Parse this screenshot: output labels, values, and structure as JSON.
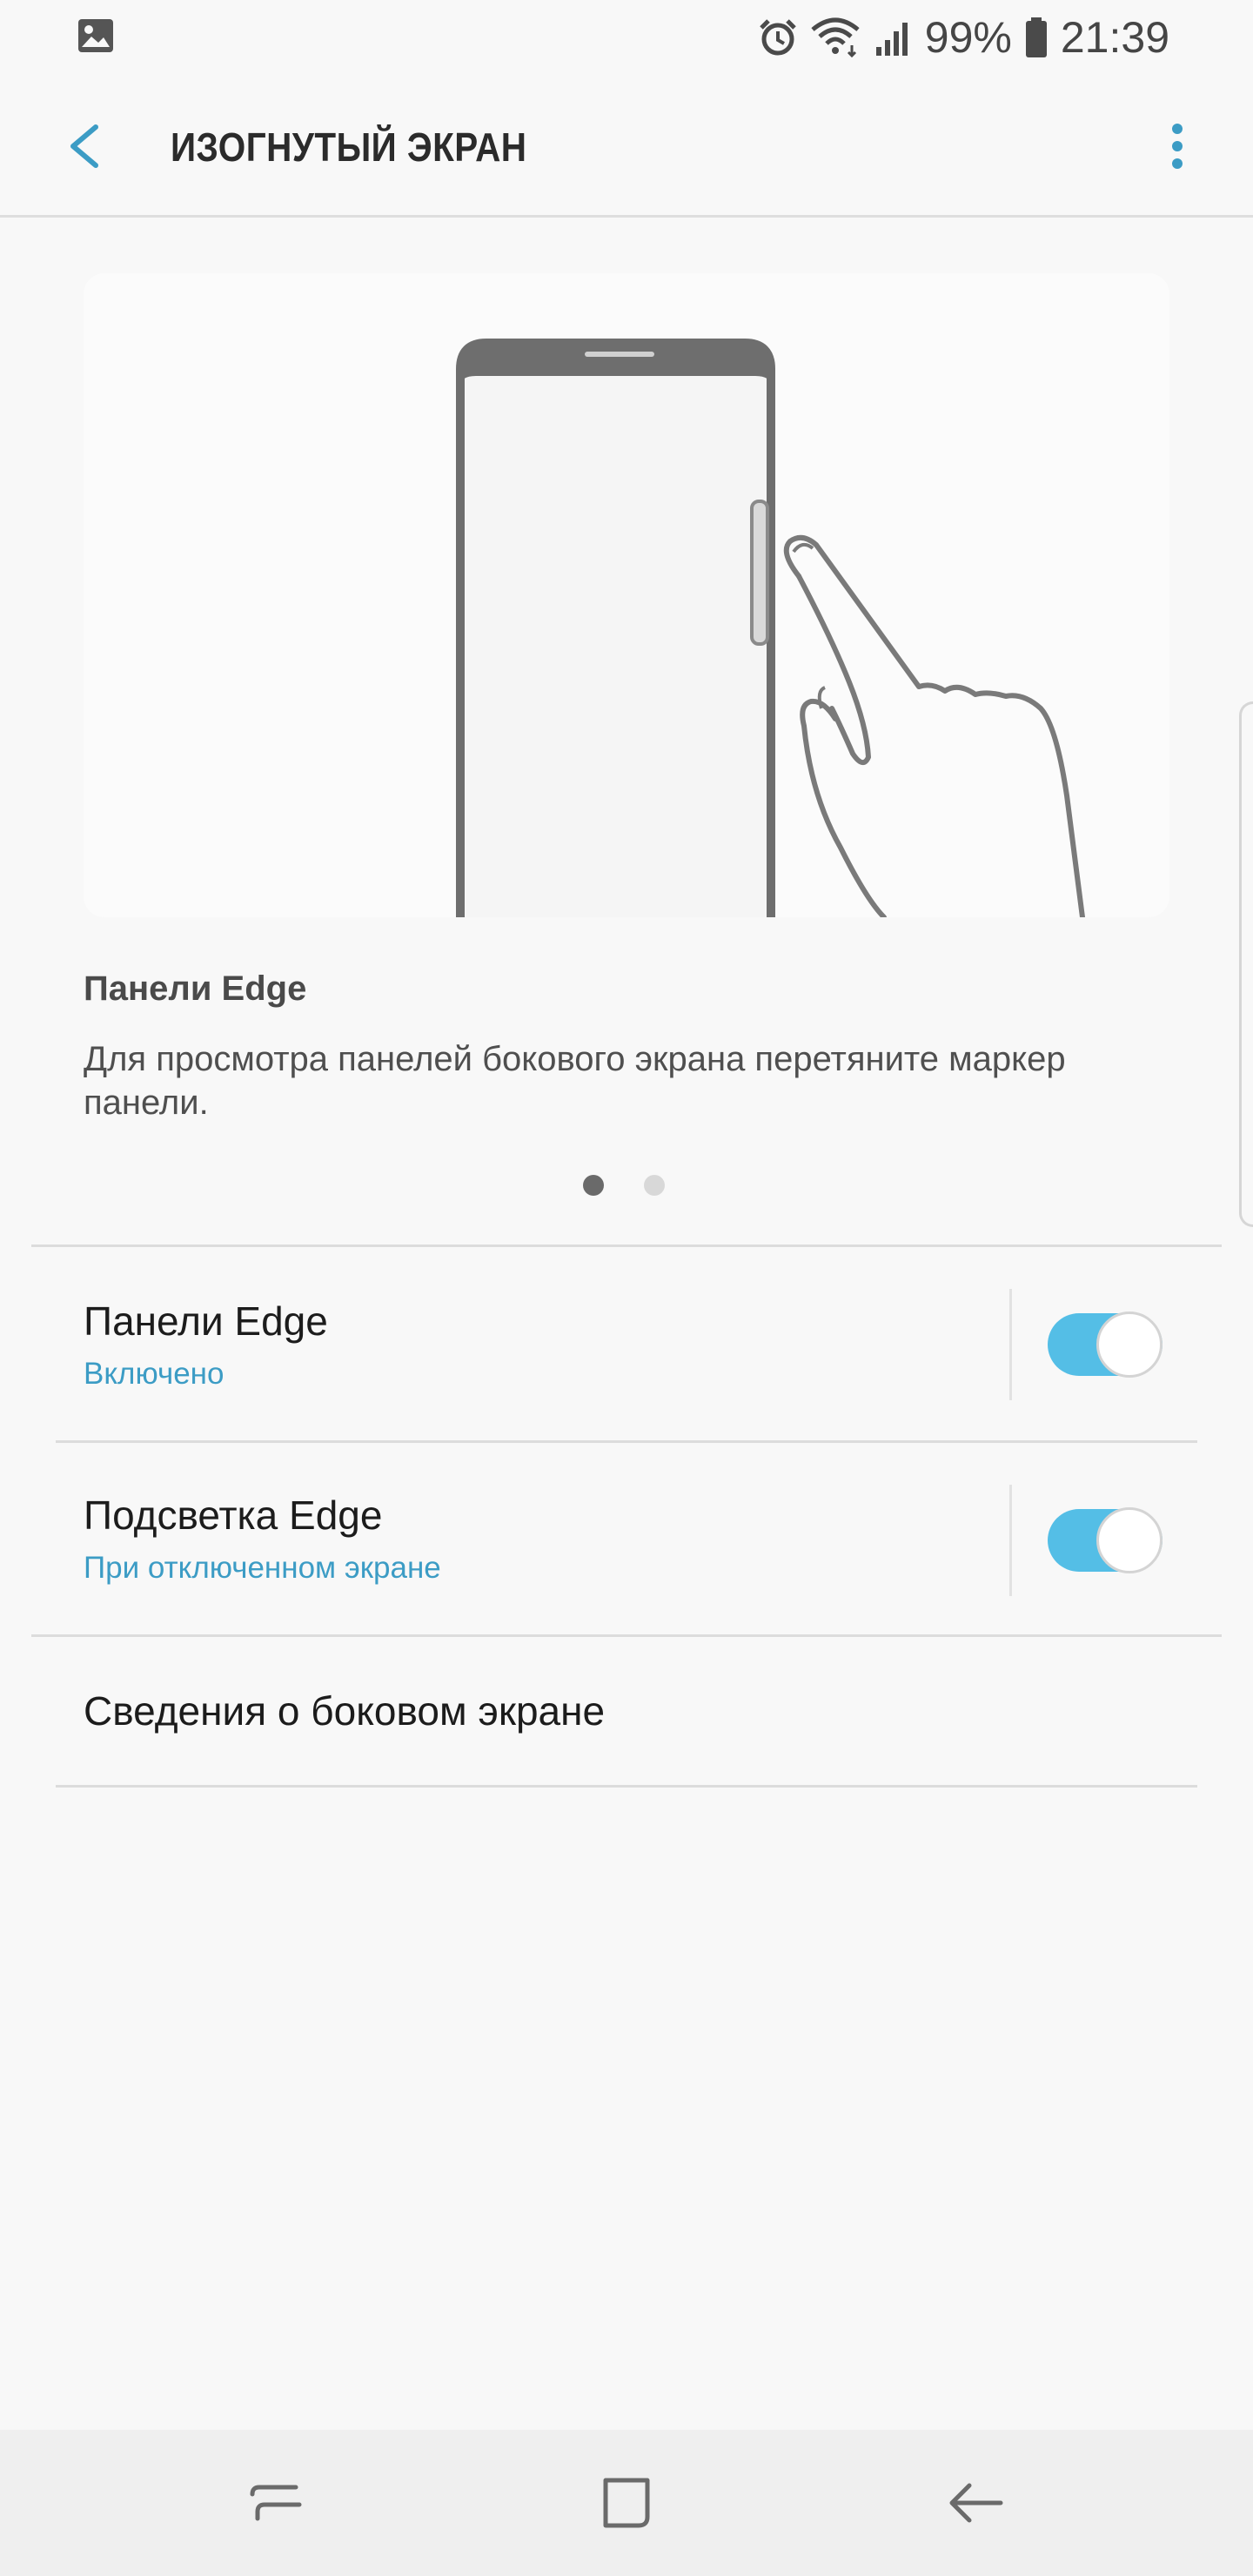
{
  "status_bar": {
    "battery": "99%",
    "time": "21:39",
    "icons": [
      "gallery-icon",
      "alarm-icon",
      "wifi-icon",
      "signal-icon",
      "battery-icon"
    ]
  },
  "app_bar": {
    "title": "ИЗОГНУТЫЙ ЭКРАН",
    "icons": [
      "back-arrow-icon",
      "more-options-icon"
    ]
  },
  "illustration": {
    "title": "Панели Edge",
    "description": "Для просмотра панелей бокового экрана перетяните маркер панели.",
    "page_count": 2,
    "active_page": 1
  },
  "settings": [
    {
      "title": "Панели Edge",
      "subtitle": "Включено",
      "toggle_on": true
    },
    {
      "title": "Подсветка Edge",
      "subtitle": "При отключенном экране",
      "toggle_on": true
    },
    {
      "title": "Сведения о боковом экране"
    }
  ],
  "nav_bar": {
    "icons": [
      "recent-apps-icon",
      "home-icon",
      "back-icon"
    ]
  },
  "colors": {
    "accent": "#3c9cc5",
    "toggle": "#54bee6",
    "background": "#f8f8f8"
  }
}
